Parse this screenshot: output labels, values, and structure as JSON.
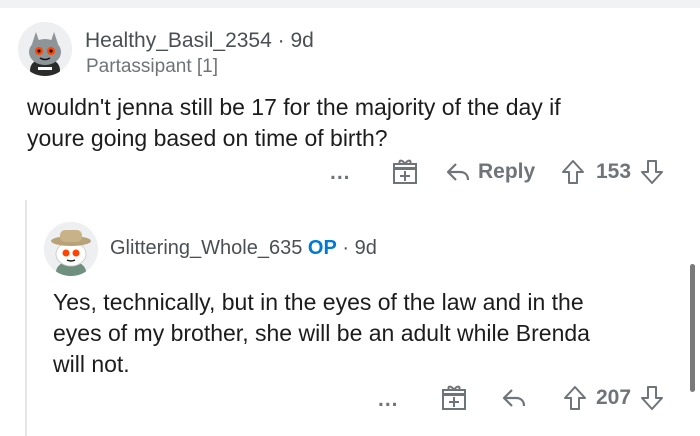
{
  "comments": [
    {
      "username": "Healthy_Basil_2354",
      "age": "9d",
      "flair": "Partassipant [1]",
      "body_lines": [
        "wouldn't jenna still be 17 for the majority of the day if",
        "youre going based on time of birth?"
      ],
      "actions": {
        "more": "...",
        "reply_label": "Reply",
        "score": "153"
      }
    },
    {
      "username": "Glittering_Whole_635",
      "op_tag": "OP",
      "age": "9d",
      "body_lines": [
        "Yes, technically, but in the eyes of the law and in the",
        "eyes of my brother, she will be an adult while Brenda",
        "will not."
      ],
      "actions": {
        "more": "...",
        "score": "207"
      }
    }
  ],
  "colors": {
    "accent_op": "#0079d3",
    "meta_text": "#6f7479",
    "body_text": "#1c1c1c",
    "avatar_bg": "#edeff1"
  },
  "icons": [
    "more-icon",
    "award-gift-icon",
    "reply-arrow-icon",
    "upvote-arrow-icon",
    "downvote-arrow-icon"
  ]
}
